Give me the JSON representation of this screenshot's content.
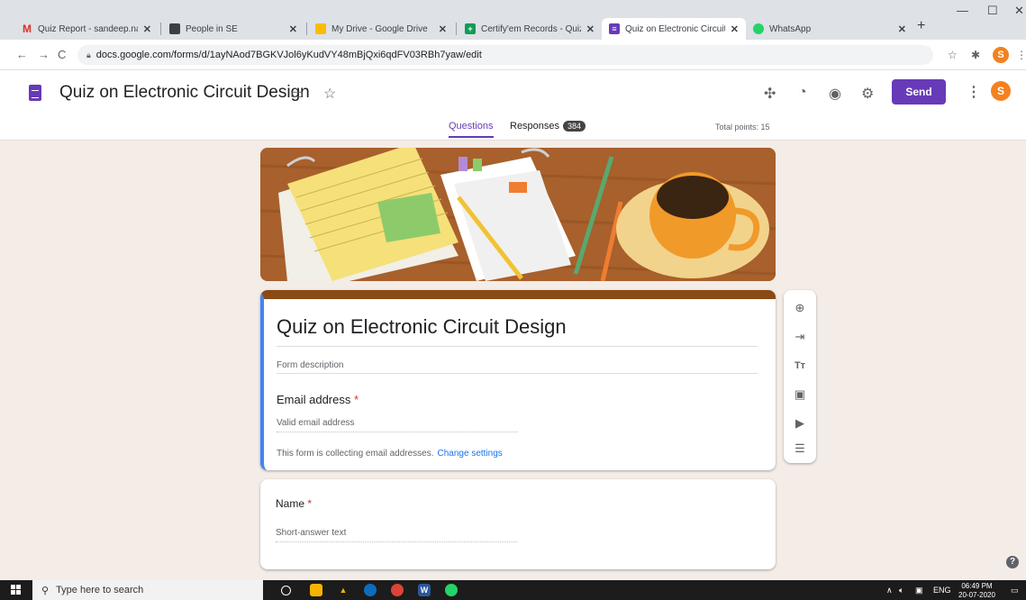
{
  "browser": {
    "tabs": [
      {
        "label": "Quiz Report - sandeep.nalag",
        "icon": "gmail-icon",
        "color": "#d93025",
        "glyph": "M"
      },
      {
        "label": "People in SE",
        "icon": "people-icon",
        "color": "#3c4043",
        "glyph": "▣"
      },
      {
        "label": "My Drive - Google Drive",
        "icon": "drive-icon",
        "color": "#1fa463",
        "glyph": "▲"
      },
      {
        "label": "Certify'em Records - Quiz on",
        "icon": "sheets-icon",
        "color": "#0f9d58",
        "glyph": "▦"
      },
      {
        "label": "Quiz on Electronic Circuit De",
        "icon": "forms-icon",
        "color": "#673ab7",
        "glyph": "≡"
      },
      {
        "label": "WhatsApp",
        "icon": "whatsapp-icon",
        "color": "#25d366",
        "glyph": "✆"
      }
    ],
    "url": "docs.google.com/forms/d/1ayNAod7BGKVJol6yKudVY48mBjQxi6qdFV03RBh7yaw/edit",
    "profile_initial": "S"
  },
  "header": {
    "title": "Quiz on Electronic Circuit Design",
    "send_label": "Send",
    "profile_initial": "S",
    "tabs": {
      "questions": "Questions",
      "responses": "Responses",
      "responses_count": "384"
    },
    "total_points": "Total points: 15"
  },
  "form": {
    "title": "Quiz on  Electronic Circuit Design",
    "description_placeholder": "Form description",
    "email_label": "Email address",
    "email_placeholder": "Valid email address",
    "collecting_note": "This form is collecting email addresses.",
    "change_settings": "Change settings",
    "questions": [
      {
        "label": "Name",
        "placeholder": "Short-answer text",
        "required": true
      }
    ]
  },
  "taskbar": {
    "search_placeholder": "Type here to search",
    "language": "ENG",
    "time": "06:49 PM",
    "date": "20-07-2020"
  },
  "colors": {
    "accent": "#673ab7",
    "header_bar": "#8a4a14",
    "required": "#d93025",
    "link": "#1a73e8"
  }
}
